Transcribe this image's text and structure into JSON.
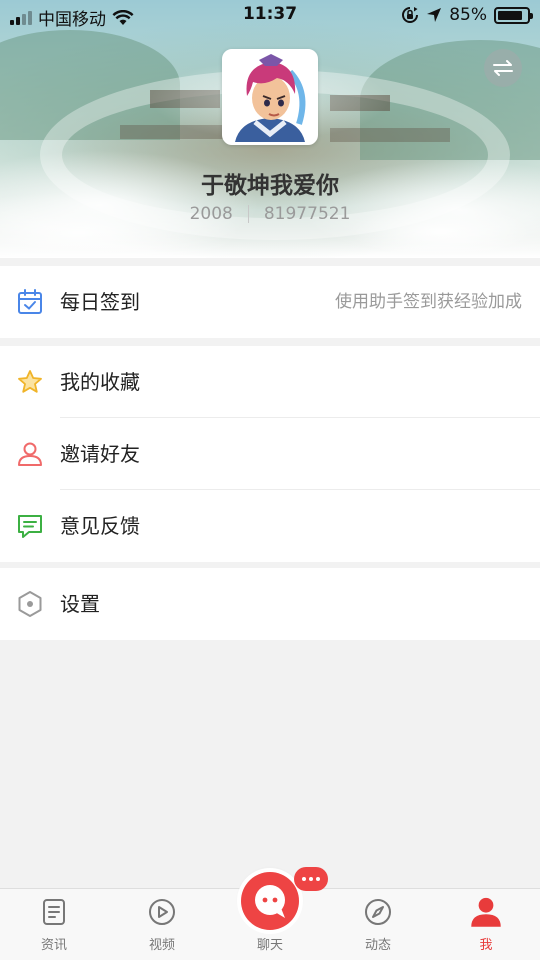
{
  "status_bar": {
    "carrier": "中国移动",
    "time": "11:37",
    "battery_percent": "85%",
    "battery_level": 0.85
  },
  "profile": {
    "nickname": "于敬坤我爱你",
    "number_a": "2008",
    "number_b": "81977521"
  },
  "menu": {
    "checkin": {
      "label": "每日签到",
      "hint": "使用助手签到获经验加成",
      "icon": "calendar-check-icon",
      "color": "#4a86e8"
    },
    "favorites": {
      "label": "我的收藏",
      "icon": "star-icon",
      "color": "#f0b429"
    },
    "invite": {
      "label": "邀请好友",
      "icon": "user-icon",
      "color": "#f06a6a"
    },
    "feedback": {
      "label": "意见反馈",
      "icon": "message-icon",
      "color": "#3cb043"
    },
    "settings": {
      "label": "设置",
      "icon": "hexagon-settings-icon",
      "color": "#9a9a9a"
    }
  },
  "tabbar": {
    "tabs": [
      {
        "label": "资讯",
        "icon": "news-icon"
      },
      {
        "label": "视频",
        "icon": "play-icon"
      },
      {
        "label": "聊天",
        "icon": "chat-bubble-icon"
      },
      {
        "label": "动态",
        "icon": "compass-icon"
      },
      {
        "label": "我",
        "icon": "person-icon",
        "active": true
      }
    ],
    "accent": "#e83b3b"
  }
}
